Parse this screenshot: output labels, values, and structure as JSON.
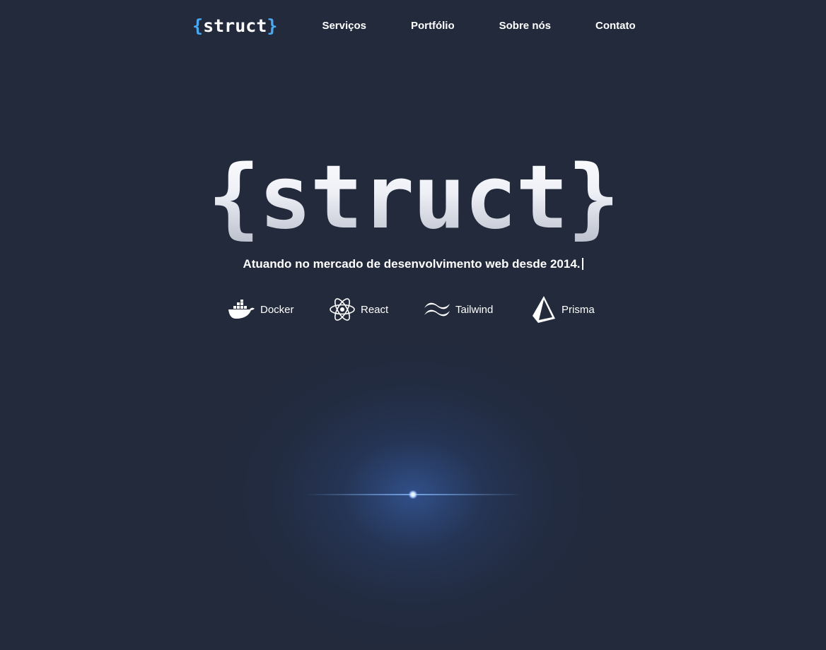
{
  "nav": {
    "logo": {
      "open_brace": "{",
      "word": "struct",
      "close_brace": "}"
    },
    "links": [
      {
        "label": "Serviços"
      },
      {
        "label": "Portfólio"
      },
      {
        "label": "Sobre nós"
      },
      {
        "label": "Contato"
      }
    ]
  },
  "hero": {
    "logo_text": "{struct}",
    "tagline": "Atuando no mercado de desenvolvimento web desde 2014."
  },
  "technologies": [
    {
      "name": "Docker",
      "icon": "docker-icon"
    },
    {
      "name": "React",
      "icon": "react-icon"
    },
    {
      "name": "Tailwind",
      "icon": "tailwind-icon"
    },
    {
      "name": "Prisma",
      "icon": "prisma-icon"
    }
  ],
  "colors": {
    "background": "#222a3c",
    "accent_brace": "#4aa8f0",
    "text": "#ffffff",
    "glow": "#3c6ec8"
  }
}
